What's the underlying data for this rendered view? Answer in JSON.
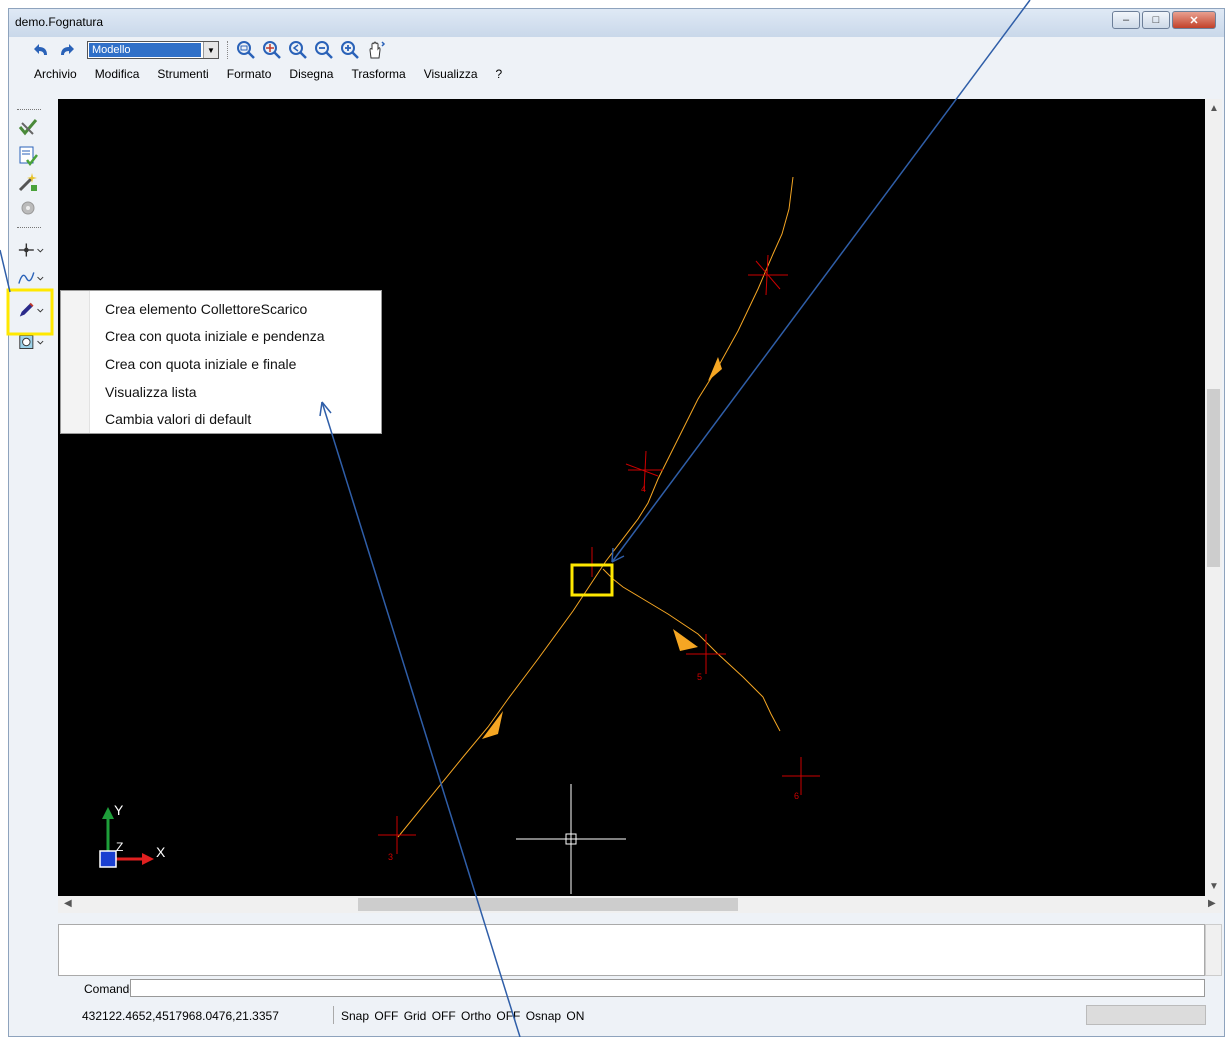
{
  "window": {
    "title": "demo.Fognatura"
  },
  "toolbar": {
    "view_select": "Modello",
    "buttons": [
      "undo-icon",
      "redo-icon",
      "zoom-window-icon",
      "zoom-all-icon",
      "zoom-previous-icon",
      "zoom-out-icon",
      "zoom-in-icon",
      "pan-icon"
    ]
  },
  "menu": {
    "items": [
      "Archivio",
      "Modifica",
      "Strumenti",
      "Formato",
      "Disegna",
      "Trasforma",
      "Visualizza",
      "?"
    ]
  },
  "context_menu": {
    "items": [
      "Crea elemento CollettoreScarico",
      "Crea con quota iniziale e pendenza",
      "Crea con quota iniziale e finale",
      "Visualizza lista",
      "Cambia valori di default"
    ]
  },
  "canvas": {
    "node_labels": [
      "3",
      "5",
      "6"
    ],
    "axis_y": "Y",
    "axis_x": "X",
    "axis_z": "Z"
  },
  "command": {
    "label": "Comando:"
  },
  "status": {
    "coords": "432122.4652,4517968.0476,21.3357",
    "modes": "Snap OFF   Grid OFF   Ortho OFF   Osnap ON"
  },
  "colors": {
    "highlight": "#ffe800",
    "pipe": "#f5a623",
    "node": "#cc0000",
    "annotation_arrow": "#2f5ea8"
  }
}
